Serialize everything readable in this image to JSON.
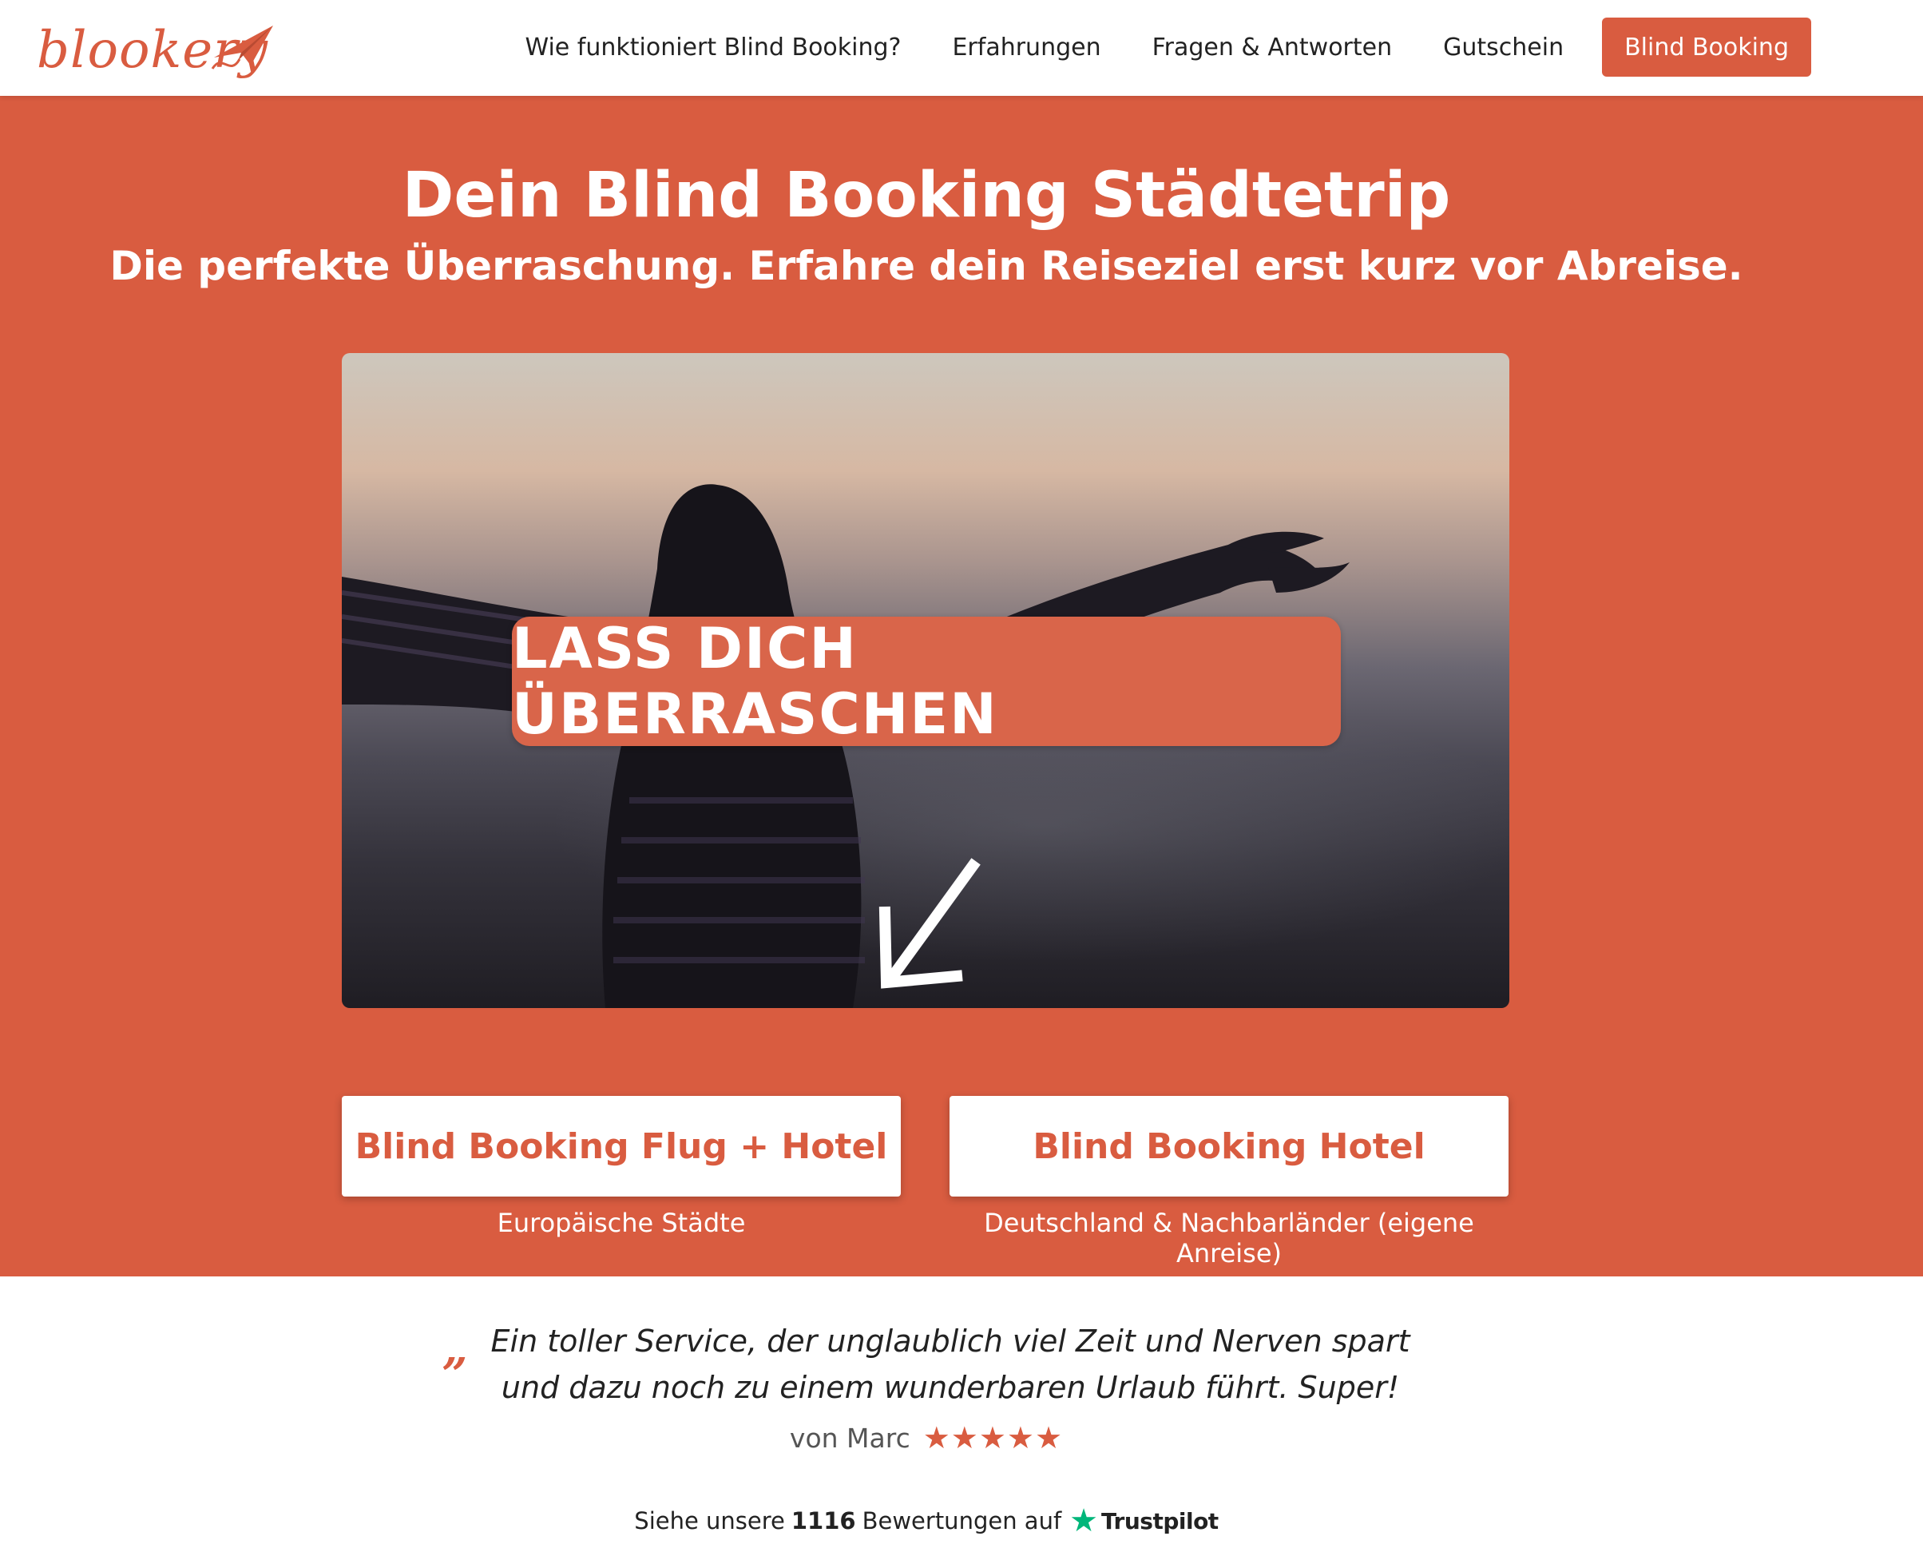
{
  "brand": {
    "name": "blookery",
    "accent": "#d95c40"
  },
  "nav": {
    "links": [
      "Wie funktioniert Blind Booking?",
      "Erfahrungen",
      "Fragen & Antworten",
      "Gutschein"
    ],
    "cta": "Blind Booking"
  },
  "hero": {
    "title": "Dein Blind Booking Städtetrip",
    "subtitle": "Die perfekte Überraschung. Erfahre dein Reiseziel erst kurz vor Abreise.",
    "cta": "LASS DICH ÜBERRASCHEN"
  },
  "options": [
    {
      "label": "Blind Booking Flug + Hotel",
      "caption": "Europäische Städte"
    },
    {
      "label": "Blind Booking Hotel",
      "caption": "Deutschland & Nachbarländer (eigene Anreise)"
    }
  ],
  "testimonial": {
    "quote_mark": "„",
    "text": "Ein toller Service, der unglaublich viel Zeit und Nerven spart und dazu noch zu einem wunderbaren Urlaub führt. Super!",
    "author": "von Marc",
    "stars": "★★★★★"
  },
  "trustpilot": {
    "prefix": "Siehe unsere",
    "count": "1116",
    "suffix": "Bewertungen auf",
    "star": "★",
    "name": "Trustpilot"
  }
}
